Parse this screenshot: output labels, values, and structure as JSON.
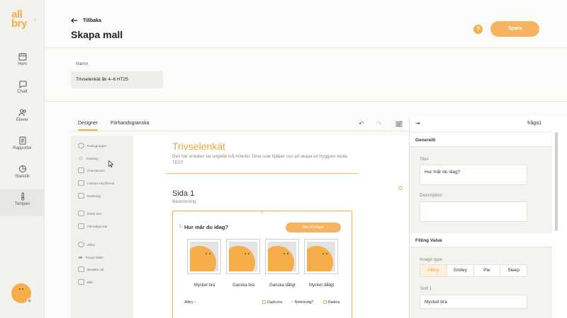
{
  "brand": {
    "logo_line1": "all",
    "logo_line2": "bry",
    "accent": "#f6ae4b"
  },
  "nav": [
    {
      "label": "Hem",
      "icon": "calendar-icon"
    },
    {
      "label": "Chatt",
      "icon": "chat-icon"
    },
    {
      "label": "Elever",
      "icon": "users-icon"
    },
    {
      "label": "Rapporter",
      "icon": "report-icon"
    },
    {
      "label": "Statistik",
      "icon": "pie-chart-icon"
    },
    {
      "label": "Tempen",
      "icon": "thermometer-icon"
    }
  ],
  "header": {
    "back_label": "Tillbaka",
    "title": "Skapa mall",
    "help": "?",
    "save_label": "Spara"
  },
  "name": {
    "label": "Namn",
    "value": "Trivselenkät åk 4–6 HT25"
  },
  "tabs": [
    "Designer",
    "Förhandsgranska"
  ],
  "toolbox": [
    "Radiogrupper",
    "Ranking",
    "Checkboxes",
    "Listruta med flerval",
    "Rankning",
    "Enkel text",
    "Flerradigt svar",
    "Allbry",
    "Range slider",
    "Bestaka val",
    "Bild"
  ],
  "survey": {
    "title": "Trivselenkät",
    "description": "Den här enkäten tar ungefär två minuter. Dina svar hjälper oss att skapa en tryggare skola. TEST",
    "page_title": "Sida 1",
    "page_description": "Beskrivning"
  },
  "question": {
    "number": "1.",
    "text": "Hur mår du idag?",
    "add_button": "Bild till frågan",
    "choices": [
      "Mycket bra",
      "Ganska bra",
      "Ganska dåligt",
      "Mycket dåligt"
    ],
    "type_label": "Allbry",
    "footer": [
      "Duplicera",
      "Nödvändig?",
      "Radera"
    ]
  },
  "panel": {
    "question_name": "fråga1",
    "general_section": "Generellt",
    "title_label": "Titel",
    "title_value": "Hur mår du idag?",
    "description_label": "Description",
    "description_value": "",
    "filling_section": "Filling Value",
    "image_type_label": "Image type",
    "image_types": [
      "Allbry",
      "Smiley",
      "Pie",
      "Sleep"
    ],
    "image_type_selected": "Allbry",
    "text1_label": "Text 1",
    "text1_value": "Mycket bra"
  }
}
